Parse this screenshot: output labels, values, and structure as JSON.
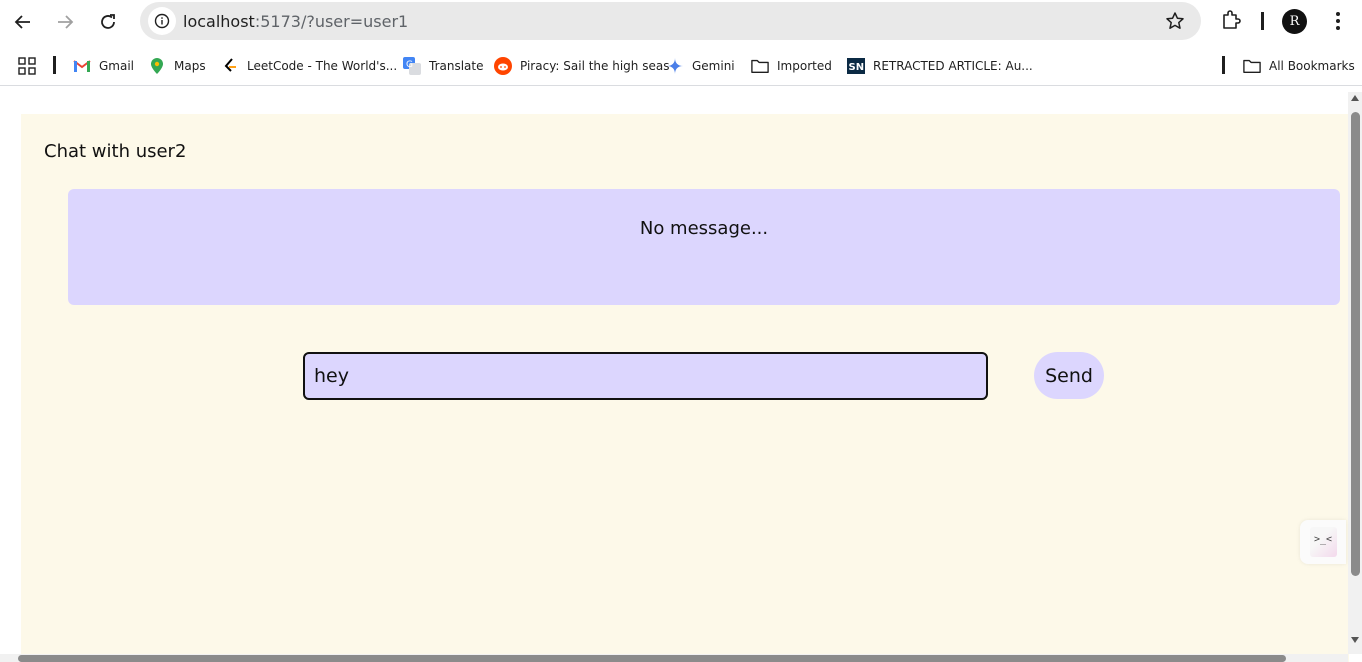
{
  "browser": {
    "url_host": "localhost",
    "url_rest": ":5173/?user=user1",
    "profile_initial": "R"
  },
  "bookmarks": {
    "items": [
      {
        "label": "Gmail",
        "icon": "gmail-icon"
      },
      {
        "label": "Maps",
        "icon": "maps-icon"
      },
      {
        "label": "LeetCode - The World's...",
        "icon": "leetcode-icon"
      },
      {
        "label": "Translate",
        "icon": "translate-icon"
      },
      {
        "label": "Piracy: Sail the high seas",
        "icon": "reddit-icon"
      },
      {
        "label": "Gemini",
        "icon": "gemini-icon"
      },
      {
        "label": "Imported",
        "icon": "folder-icon"
      },
      {
        "label": "RETRACTED ARTICLE: Au...",
        "icon": "sn-icon"
      }
    ],
    "all_bookmarks": "All Bookmarks"
  },
  "chat": {
    "title": "Chat with user2",
    "empty_text": "No message...",
    "input_value": "hey",
    "send_label": "Send"
  },
  "widget": {
    "glyph": ">_<"
  },
  "colors": {
    "app_bg": "#fdf9e9",
    "accent": "#dcd6fe"
  }
}
